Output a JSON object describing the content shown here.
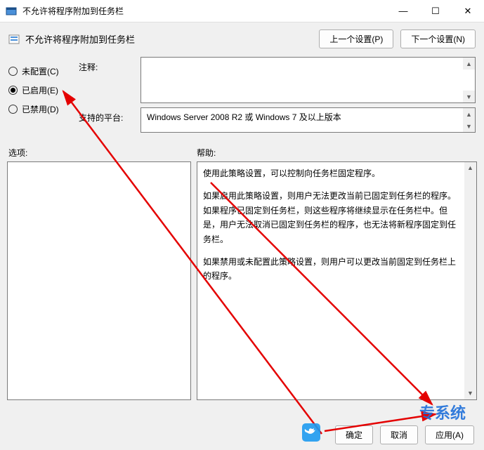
{
  "window": {
    "title": "不允许将程序附加到任务栏",
    "minimize": "—",
    "maximize": "☐",
    "close": "✕"
  },
  "header": {
    "title": "不允许将程序附加到任务栏",
    "prev": "上一个设置(P)",
    "next": "下一个设置(N)"
  },
  "state": {
    "not_configured": "未配置(C)",
    "enabled": "已启用(E)",
    "disabled": "已禁用(D)",
    "selected": "enabled"
  },
  "fields": {
    "comment_label": "注释:",
    "platform_label": "支持的平台:",
    "platform_text": "Windows Server 2008 R2 或 Windows 7 及以上版本"
  },
  "sections": {
    "options": "选项:",
    "help": "帮助:"
  },
  "help_text": {
    "p1": "使用此策略设置，可以控制向任务栏固定程序。",
    "p2": "如果启用此策略设置，则用户无法更改当前已固定到任务栏的程序。如果程序已固定到任务栏，则这些程序将继续显示在任务栏中。但是，用户无法取消已固定到任务栏的程序，也无法将新程序固定到任务栏。",
    "p3": "如果禁用或未配置此策略设置，则用户可以更改当前固定到任务栏上的程序。"
  },
  "footer": {
    "ok": "确定",
    "cancel": "取消",
    "apply": "应用(A)"
  },
  "glyphs": {
    "up": "▲",
    "down": "▼"
  }
}
